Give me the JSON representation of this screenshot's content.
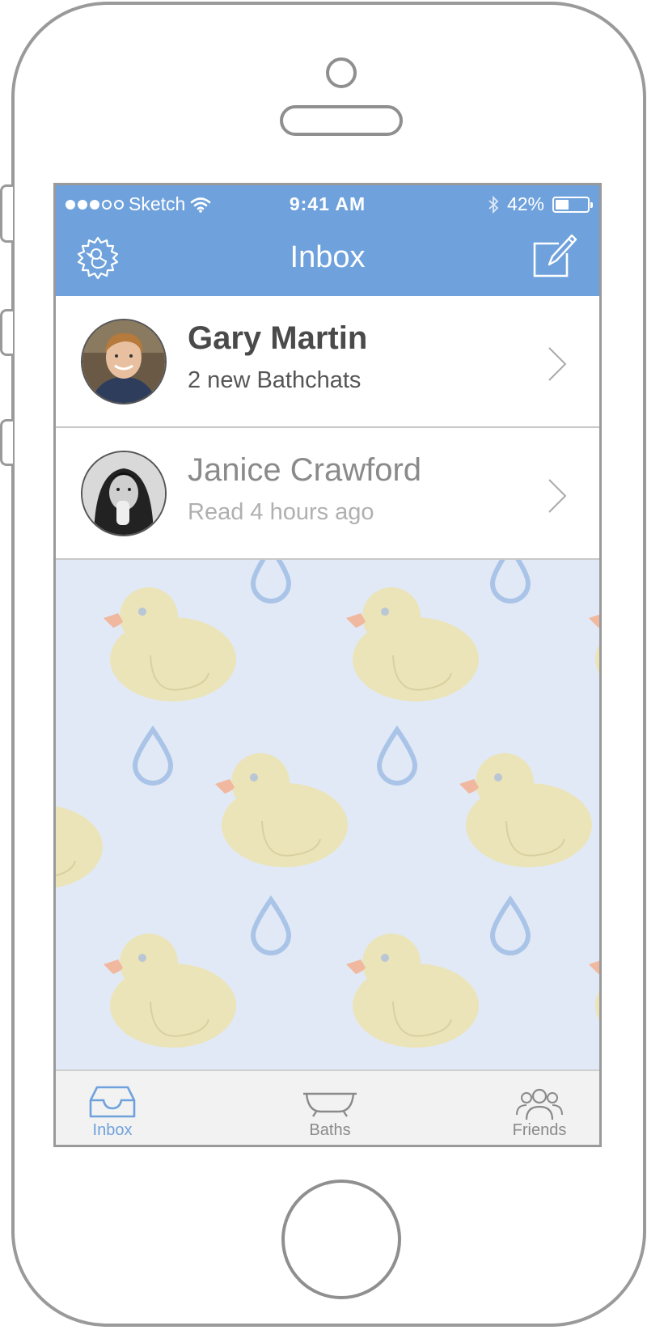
{
  "status_bar": {
    "carrier": "Sketch",
    "time": "9:41 AM",
    "battery_percent": "42%",
    "battery_level": 0.42,
    "signal_bars_filled": 3,
    "signal_bars_total": 5
  },
  "nav": {
    "title": "Inbox",
    "left_icon": "duck-settings-gear-icon",
    "right_icon": "compose-icon"
  },
  "conversations": [
    {
      "name": "Gary Martin",
      "subtitle": "2 new Bathchats",
      "state": "unread"
    },
    {
      "name": "Janice Crawford",
      "subtitle": "Read 4 hours ago",
      "state": "read"
    }
  ],
  "tabs": [
    {
      "label": "Inbox",
      "icon": "inbox-tray-icon",
      "active": true
    },
    {
      "label": "Baths",
      "icon": "bathtub-icon",
      "active": false
    },
    {
      "label": "Friends",
      "icon": "friends-icon",
      "active": false
    }
  ],
  "colors": {
    "accent": "#6fa2dc",
    "background_pattern": "#e1e9f6",
    "duck": "#ebe4b8",
    "drop": "#aac4e8"
  }
}
